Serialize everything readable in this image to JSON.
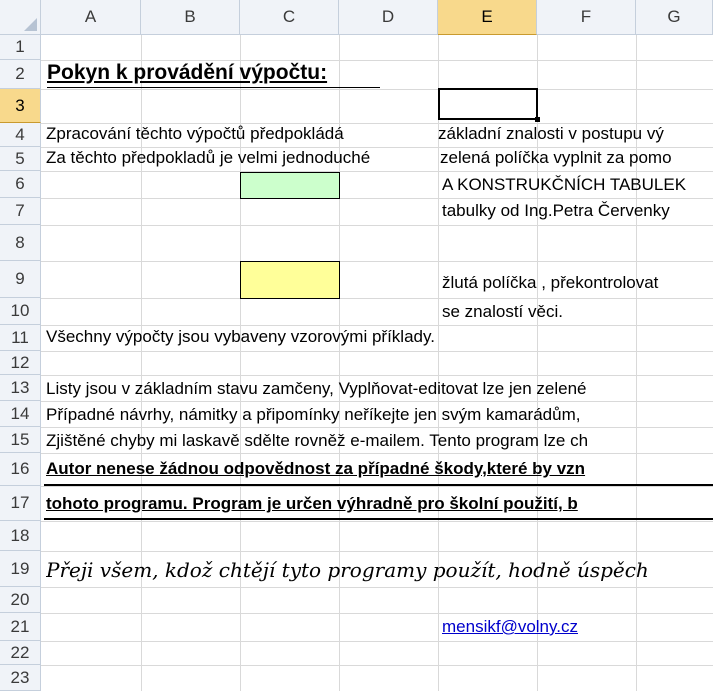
{
  "columns": [
    "A",
    "B",
    "C",
    "D",
    "E",
    "F",
    "G"
  ],
  "rows": [
    "1",
    "2",
    "3",
    "4",
    "5",
    "6",
    "7",
    "8",
    "9",
    "10",
    "11",
    "12",
    "13",
    "14",
    "15",
    "16",
    "17",
    "18",
    "19",
    "20",
    "21",
    "22",
    "23"
  ],
  "active_cell": "E3",
  "colors": {
    "green_cell": "#ccffcc",
    "yellow_cell": "#ffff99",
    "header_bg": "#f0f3f8",
    "header_selected": "#f8d98c",
    "grid": "#d9d9d9",
    "link": "#0000cc"
  },
  "cells": {
    "r2": "Pokyn k provádění výpočtu:",
    "r4a": "Zpracování těchto  výpočtů  předpokládá",
    "r4b": "základní znalosti v  postupu  vý",
    "r5a": "Za těchto předpokladů je velmi jednoduché",
    "r5b": "zelená políčka vyplnit za pomo",
    "r6": "A KONSTRUKČNÍCH TABULEK",
    "r7": "tabulky od Ing.Petra Červenky",
    "r9": "žlutá políčka ,  překontrolovat",
    "r10": " se znalostí věci.",
    "r11": "Všechny  výpočty jsou vybaveny vzorovými příklady.",
    "r13": " Listy jsou v základním stavu zamčeny, Vyplňovat-editovat lze jen zelené",
    "r14": "Případné  návrhy, námitky a připomínky neříkejte jen  svým kamarádům,",
    "r15": " Zjištěné chyby mi laskavě sdělte rovněž e-mailem. Tento program lze ch",
    "r16": "Autor nenese žádnou odpovědnost za případné škody,které by vzn",
    "r17": "tohoto programu. Program je určen výhradně pro školní použití, b",
    "r19": "Přeji všem, kdož chtějí tyto  programy  použít, hodně úspěch",
    "r21": "mensikf@volny.cz"
  }
}
